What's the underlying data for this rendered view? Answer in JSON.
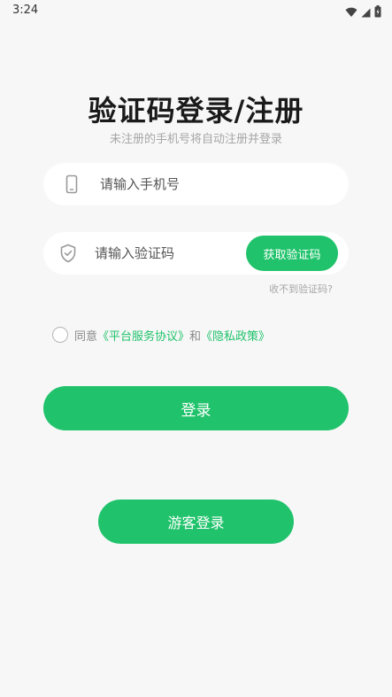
{
  "status_bar": {
    "time": "3:24",
    "icons": [
      "wifi-icon",
      "signal-icon",
      "battery-icon"
    ]
  },
  "header": {
    "title": "验证码登录/注册",
    "subtitle": "未注册的手机号将自动注册并登录"
  },
  "phone_field": {
    "icon": "phone-icon",
    "placeholder": "请输入手机号",
    "value": ""
  },
  "code_field": {
    "icon": "shield-check-icon",
    "placeholder": "请输入验证码",
    "value": "",
    "get_code_label": "获取验证码"
  },
  "not_received_label": "收不到验证码?",
  "agreement": {
    "checked": false,
    "prefix": "同意",
    "terms_link": "《平台服务协议》",
    "conjunction": "和",
    "privacy_link": "《隐私政策》"
  },
  "login_button_label": "登录",
  "guest_login_label": "游客登录",
  "colors": {
    "accent": "#20c36b",
    "background": "#f7f7f7",
    "field_background": "#ffffff",
    "muted_text": "#a6a6a6"
  }
}
